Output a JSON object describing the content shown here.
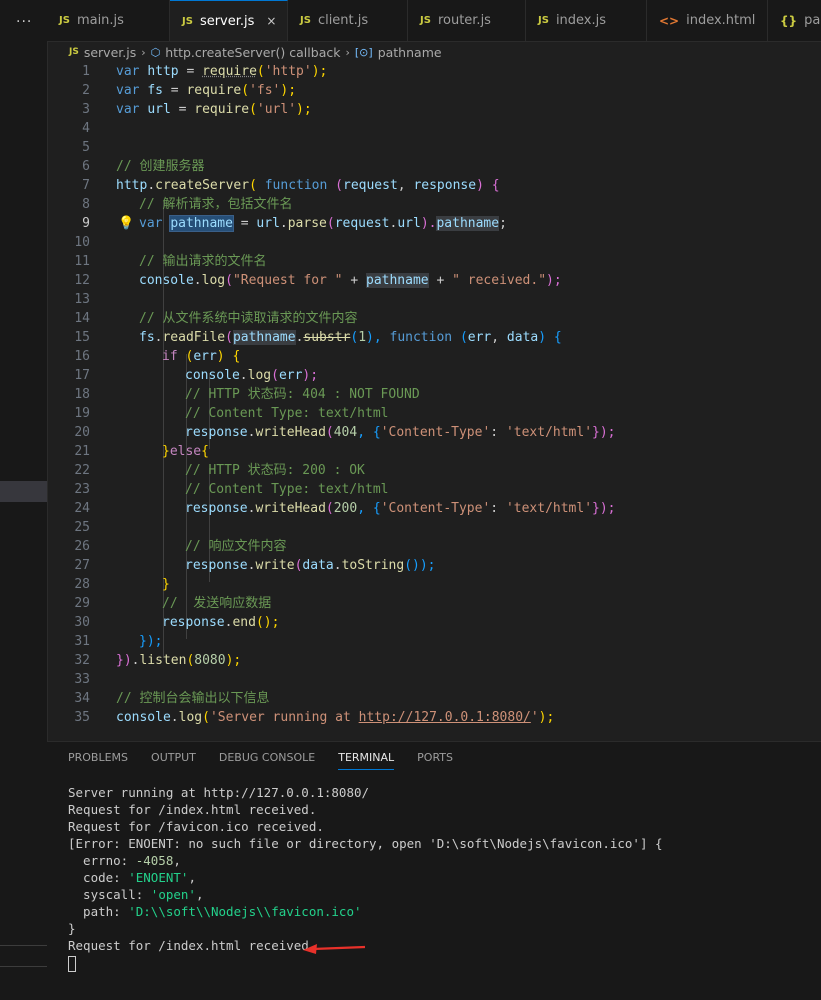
{
  "sidebar": {
    "menu": "···"
  },
  "tabs": [
    {
      "icon": "JS",
      "label": "main.js"
    },
    {
      "icon": "JS",
      "label": "server.js",
      "close": "×"
    },
    {
      "icon": "JS",
      "label": "client.js"
    },
    {
      "icon": "JS",
      "label": "router.js"
    },
    {
      "icon": "JS",
      "label": "index.js"
    },
    {
      "icon": "<>",
      "label": "index.html"
    },
    {
      "icon": "{}",
      "label": "package.json"
    }
  ],
  "breadcrumb": {
    "icon": "JS",
    "file": "server.js",
    "fn": "http.createServer() callback",
    "symbol": "pathname"
  },
  "editor": {
    "lines": [
      {
        "n": "1"
      },
      {
        "n": "2"
      },
      {
        "n": "3"
      },
      {
        "n": "4"
      },
      {
        "n": "5"
      },
      {
        "n": "6"
      },
      {
        "n": "7"
      },
      {
        "n": "8"
      },
      {
        "n": "9"
      },
      {
        "n": "10"
      },
      {
        "n": "11"
      },
      {
        "n": "12"
      },
      {
        "n": "13"
      },
      {
        "n": "14"
      },
      {
        "n": "15"
      },
      {
        "n": "16"
      },
      {
        "n": "17"
      },
      {
        "n": "18"
      },
      {
        "n": "19"
      },
      {
        "n": "20"
      },
      {
        "n": "21"
      },
      {
        "n": "22"
      },
      {
        "n": "23"
      },
      {
        "n": "24"
      },
      {
        "n": "25"
      },
      {
        "n": "26"
      },
      {
        "n": "27"
      },
      {
        "n": "28"
      },
      {
        "n": "29"
      },
      {
        "n": "30"
      },
      {
        "n": "31"
      },
      {
        "n": "32"
      },
      {
        "n": "33"
      },
      {
        "n": "34"
      },
      {
        "n": "35"
      }
    ],
    "code": {
      "l1": [
        "var",
        " ",
        "http",
        " = ",
        "require",
        "(",
        "'http'",
        ");"
      ],
      "l2": [
        "var",
        " ",
        "fs",
        " = ",
        "require",
        "(",
        "'fs'",
        ");"
      ],
      "l3": [
        "var",
        " ",
        "url",
        " = ",
        "require",
        "(",
        "'url'",
        ");"
      ],
      "l6": "// 创建服务器",
      "l7": [
        "http",
        ".",
        "createServer",
        "( ",
        "function",
        " (",
        "request",
        ", ",
        "response",
        ") {"
      ],
      "l8": "// 解析请求，包括文件名",
      "l9": [
        "var",
        " ",
        "pathname",
        " = ",
        "url",
        ".",
        "parse",
        "(",
        "request",
        ".",
        "url",
        ").",
        "pathname",
        ";"
      ],
      "l11": "// 输出请求的文件名",
      "l12": [
        "console",
        ".",
        "log",
        "(",
        "\"Request for \"",
        " + ",
        "pathname",
        " + ",
        "\" received.\"",
        ");"
      ],
      "l14": "// 从文件系统中读取请求的文件内容",
      "l15": [
        "fs",
        ".",
        "readFile",
        "(",
        "pathname",
        ".",
        "substr",
        "(",
        "1",
        "), ",
        "function",
        " (",
        "err",
        ", ",
        "data",
        ") {"
      ],
      "l16": [
        "if",
        " (",
        "err",
        ") {"
      ],
      "l17": [
        "console",
        ".",
        "log",
        "(",
        "err",
        ");"
      ],
      "l18": "// HTTP 状态码: 404 : NOT FOUND",
      "l19": "// Content Type: text/html",
      "l20": [
        "response",
        ".",
        "writeHead",
        "(",
        "404",
        ", {",
        "'Content-Type'",
        ": ",
        "'text/html'",
        "});"
      ],
      "l21": [
        "}",
        "else",
        "{"
      ],
      "l22": "// HTTP 状态码: 200 : OK",
      "l23": "// Content Type: text/html",
      "l24": [
        "response",
        ".",
        "writeHead",
        "(",
        "200",
        ", {",
        "'Content-Type'",
        ": ",
        "'text/html'",
        "});"
      ],
      "l26": "// 响应文件内容",
      "l27": [
        "response",
        ".",
        "write",
        "(",
        "data",
        ".",
        "toString",
        "());"
      ],
      "l28": "}",
      "l29": "//  发送响应数据",
      "l30": [
        "response",
        ".",
        "end",
        "();"
      ],
      "l31": "});",
      "l32": [
        "})",
        ".",
        "listen",
        "(",
        "8080",
        ");"
      ],
      "l34": "// 控制台会输出以下信息",
      "l35": [
        "console",
        ".",
        "log",
        "(",
        "'Server running at ",
        "http://127.0.0.1:8080/",
        "'",
        ");"
      ]
    }
  },
  "panel": {
    "tabs": [
      "PROBLEMS",
      "OUTPUT",
      "DEBUG CONSOLE",
      "TERMINAL",
      "PORTS"
    ],
    "active_tab": "TERMINAL",
    "terminal": {
      "t1": "Server running at http://127.0.0.1:8080/",
      "t2": "Request for /index.html received.",
      "t3": "Request for /favicon.ico received.",
      "t4": "[Error: ENOENT: no such file or directory, open 'D:\\soft\\Nodejs\\favicon.ico'] {",
      "t5k": "  errno: ",
      "t5v": "-4058",
      "t5e": ",",
      "t6k": "  code: ",
      "t6v": "'ENOENT'",
      "t6e": ",",
      "t7k": "  syscall: ",
      "t7v": "'open'",
      "t7e": ",",
      "t8k": "  path: ",
      "t8v": "'D:\\\\soft\\\\Nodejs\\\\favicon.ico'",
      "t9": "}",
      "t10": "Request for /index.html received."
    }
  },
  "colors": {
    "accent": "#0078d4",
    "annotation_arrow": "#e8312a"
  }
}
